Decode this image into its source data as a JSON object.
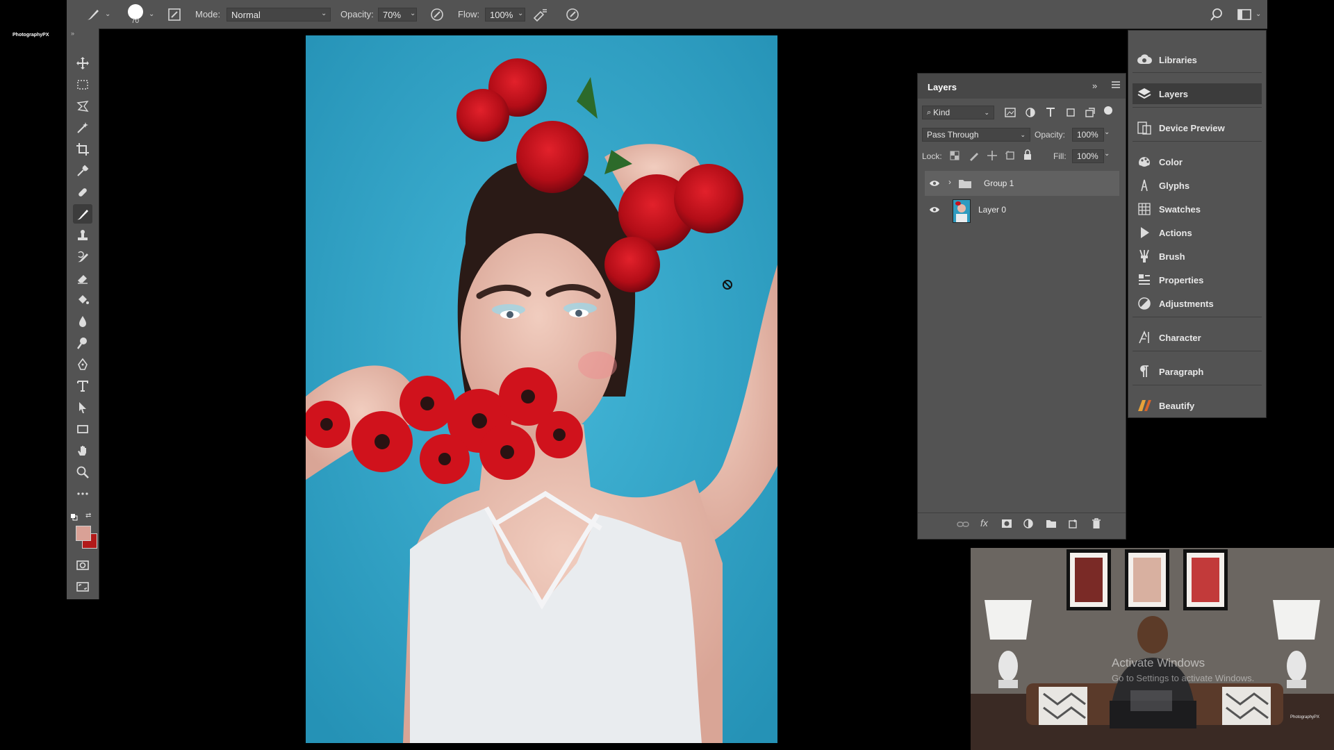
{
  "brand": {
    "logo_text": "PhotographyPX"
  },
  "options_bar": {
    "brush_size": "70",
    "mode_label": "Mode:",
    "mode_value": "Normal",
    "opacity_label": "Opacity:",
    "opacity_value": "70%",
    "flow_label": "Flow:",
    "flow_value": "100%"
  },
  "toolbar": {
    "tools": [
      "move",
      "marquee",
      "lasso",
      "magic-wand",
      "crop",
      "eyedropper",
      "healing-brush",
      "brush",
      "clone-stamp",
      "history-brush",
      "eraser",
      "paint-bucket",
      "blur",
      "dodge",
      "pen",
      "type",
      "path-selection",
      "rectangle",
      "hand",
      "zoom",
      "more"
    ],
    "active_tool": "brush",
    "foreground_color": "#d9a196",
    "background_color": "#b11a1a"
  },
  "layers_panel": {
    "title": "Layers",
    "filter_kind": "Kind",
    "blend_mode": "Pass Through",
    "opacity_label": "Opacity:",
    "opacity_value": "100%",
    "lock_label": "Lock:",
    "fill_label": "Fill:",
    "fill_value": "100%",
    "layers": [
      {
        "name": "Group 1",
        "type": "group",
        "visible": true,
        "selected": true
      },
      {
        "name": "Layer 0",
        "type": "pixel",
        "visible": true,
        "selected": false
      }
    ]
  },
  "dock": {
    "items": [
      {
        "label": "Libraries",
        "icon": "libraries-icon"
      },
      {
        "label": "Layers",
        "icon": "layers-icon",
        "selected": true
      },
      {
        "label": "Device Preview",
        "icon": "device-preview-icon"
      },
      {
        "label": "Color",
        "icon": "color-icon"
      },
      {
        "label": "Glyphs",
        "icon": "glyphs-icon"
      },
      {
        "label": "Swatches",
        "icon": "swatches-icon"
      },
      {
        "label": "Actions",
        "icon": "actions-icon"
      },
      {
        "label": "Brush",
        "icon": "brush-icon"
      },
      {
        "label": "Properties",
        "icon": "properties-icon"
      },
      {
        "label": "Adjustments",
        "icon": "adjustments-icon"
      },
      {
        "label": "Character",
        "icon": "character-icon"
      },
      {
        "label": "Paragraph",
        "icon": "paragraph-icon"
      },
      {
        "label": "Beautify",
        "icon": "beautify-icon"
      }
    ]
  },
  "webcam": {
    "watermark_title": "Activate Windows",
    "watermark_sub": "Go to Settings to activate Windows."
  },
  "colors": {
    "ui_panel": "#535353",
    "ui_dark": "#3c3c3c",
    "canvas_backdrop": "#36a6c8",
    "rose_red": "#c8101c"
  }
}
